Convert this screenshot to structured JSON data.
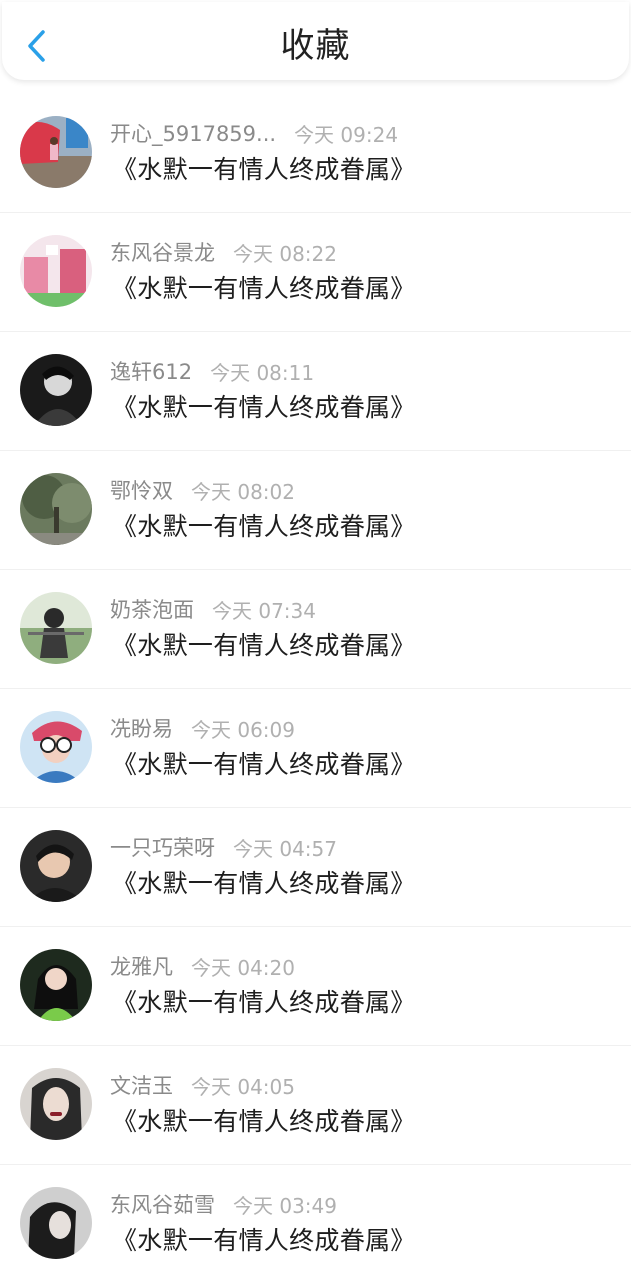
{
  "header": {
    "title": "收藏",
    "back_icon": "chevron-left-icon",
    "accent_color": "#2aa0e8"
  },
  "items": [
    {
      "user": "开心_5917859...",
      "time": "今天 09:24",
      "title": "《水默一有情人终成眷属》"
    },
    {
      "user": "东风谷景龙",
      "time": "今天 08:22",
      "title": "《水默一有情人终成眷属》"
    },
    {
      "user": "逸轩612",
      "time": "今天 08:11",
      "title": "《水默一有情人终成眷属》"
    },
    {
      "user": "鄂怜双",
      "time": "今天 08:02",
      "title": "《水默一有情人终成眷属》"
    },
    {
      "user": "奶茶泡面",
      "time": "今天 07:34",
      "title": "《水默一有情人终成眷属》"
    },
    {
      "user": "冼盼易",
      "time": "今天 06:09",
      "title": "《水默一有情人终成眷属》"
    },
    {
      "user": "一只巧荣呀",
      "time": "今天 04:57",
      "title": "《水默一有情人终成眷属》"
    },
    {
      "user": "龙雅凡",
      "time": "今天 04:20",
      "title": "《水默一有情人终成眷属》"
    },
    {
      "user": "文洁玉",
      "time": "今天 04:05",
      "title": "《水默一有情人终成眷属》"
    },
    {
      "user": "东风谷茹雪",
      "time": "今天 03:49",
      "title": "《水默一有情人终成眷属》"
    }
  ]
}
